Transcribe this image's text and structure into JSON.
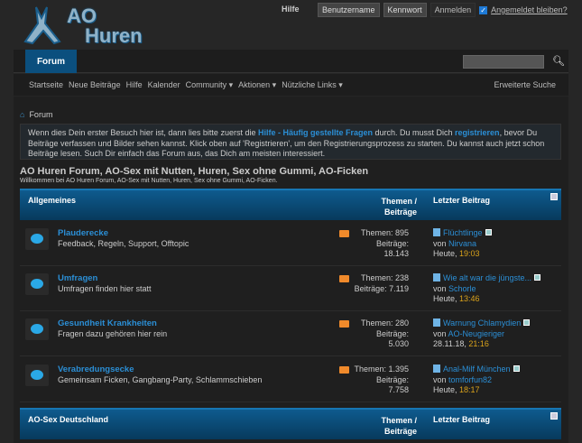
{
  "logo": {
    "line1": "AO",
    "line2": "Huren"
  },
  "topbar": {
    "help": "Hilfe",
    "username_placeholder": "Benutzername",
    "password_placeholder": "Kennwort",
    "login": "Anmelden",
    "remember": "Angemeldet bleiben?",
    "remember_checked": true
  },
  "nav": {
    "tab": "Forum",
    "search_placeholder": ""
  },
  "subnav": {
    "items": [
      "Startseite",
      "Neue Beiträge",
      "Hilfe",
      "Kalender",
      "Community ▾",
      "Aktionen ▾",
      "Nützliche Links ▾"
    ],
    "advanced": "Erweiterte Suche"
  },
  "breadcrumb": "Forum",
  "notice": {
    "t1": "Wenn dies Dein erster Besuch hier ist, dann lies bitte zuerst die ",
    "link1": "Hilfe - Häufig gestellte Fragen",
    "t2": " durch. Du musst Dich ",
    "link2": "registrieren",
    "t3": ", bevor Du Beiträge verfassen und Bilder sehen kannst. Klick oben auf 'Registrieren', um den Registrierungsprozess zu starten. Du kannst auch jetzt schon Beiträge lesen. Such Dir einfach das Forum aus, das Dich am meisten interessiert."
  },
  "title": "AO Huren Forum, AO-Sex mit Nutten, Huren, Sex ohne Gummi, AO-Ficken",
  "subtitle": "Willkommen bei AO Huren Forum, AO-Sex mit Nutten, Huren, Sex ohne Gummi, AO-Ficken.",
  "headers": {
    "topics": "Themen /",
    "posts": "Beiträge",
    "last": "Letzter Beitrag"
  },
  "categories": [
    {
      "name": "Allgemeines"
    },
    {
      "name": "AO-Sex Deutschland"
    }
  ],
  "forums": [
    {
      "name": "Plauderecke",
      "desc": "Feedback, Regeln, Support, Offtopic",
      "topics": "Themen: 895",
      "posts1": "Beiträge:",
      "posts2": "18.143",
      "last_title": "Flüchtlinge",
      "by": "von ",
      "user": "Nirvana",
      "date": "Heute, ",
      "time": "19:03"
    },
    {
      "name": "Umfragen",
      "desc": "Umfragen finden hier statt",
      "topics": "Themen: 238",
      "posts1": "Beiträge: 7.119",
      "posts2": "",
      "last_title": "Wie alt war die jüngste...",
      "by": "von ",
      "user": "Schorle",
      "date": "Heute, ",
      "time": "13:46"
    },
    {
      "name": "Gesundheit Krankheiten",
      "desc": "Fragen dazu gehören hier rein",
      "topics": "Themen: 280",
      "posts1": "Beiträge: 5.030",
      "posts2": "",
      "last_title": "Warnung Chlamydien",
      "by": "von ",
      "user": "AO-Neugieriger",
      "date": "28.11.18, ",
      "time": "21:16"
    },
    {
      "name": "Verabredungsecke",
      "desc": "Gemeinsam Ficken, Gangbang-Party, Schlammschieben",
      "topics": "Themen: 1.395",
      "posts1": "Beiträge: 7.758",
      "posts2": "",
      "last_title": "Anal-Milf München",
      "by": "von ",
      "user": "tomforfun82",
      "date": "Heute, ",
      "time": "18:17"
    }
  ]
}
